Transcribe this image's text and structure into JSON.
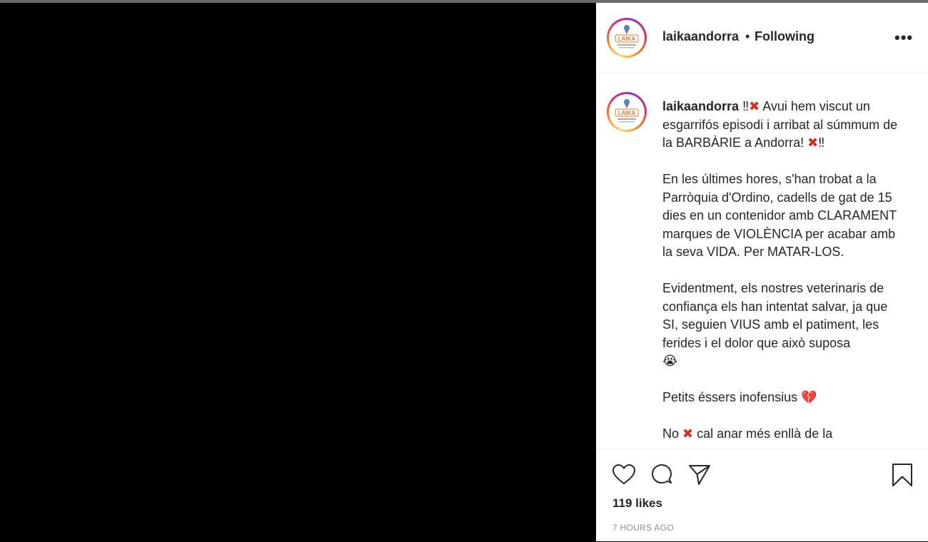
{
  "header": {
    "username": "laikaandorra",
    "separator": "•",
    "follow_status": "Following",
    "more_label": "•••"
  },
  "avatar": {
    "logo_text": "LAIKA"
  },
  "caption": {
    "username": "laikaandorra",
    "p1_a": " ‼",
    "p1_b": "Avui hem viscut un esgarrifós episodi i arribat al súmmum de la BARBÀRIE a Andorra! ",
    "p1_c": "‼",
    "p2": "En les últimes hores, s'han trobat a la Parròquia d'Ordino, cadells de gat de 15 dies en un contenidor amb CLARAMENT marques de VIOLÈNCIA per acabar amb la seva VIDA. Per MATAR-LOS.",
    "p3": "Evidentment, els nostres veterinaris de confiança els han intentat salvar, ja que SI, seguien VIUS amb el patiment, les ferides i el dolor que això suposa",
    "p4": "Petits éssers inofensius",
    "p5_a": "No ",
    "p5_b": " cal anar més enllà de la"
  },
  "icons": {
    "red_x": "✖",
    "crying_emoji": "😭",
    "broken_heart": "💔",
    "like": "heart-icon",
    "comment": "comment-icon",
    "share": "share-icon",
    "save": "bookmark-icon"
  },
  "stats": {
    "likes": "119 likes",
    "time": "7 HOURS AGO"
  },
  "colors": {
    "media_bg": "#000000",
    "panel_bg": "#ffffff",
    "text": "#262626",
    "muted": "#8e8e8e",
    "red_x": "#d42b1b"
  }
}
